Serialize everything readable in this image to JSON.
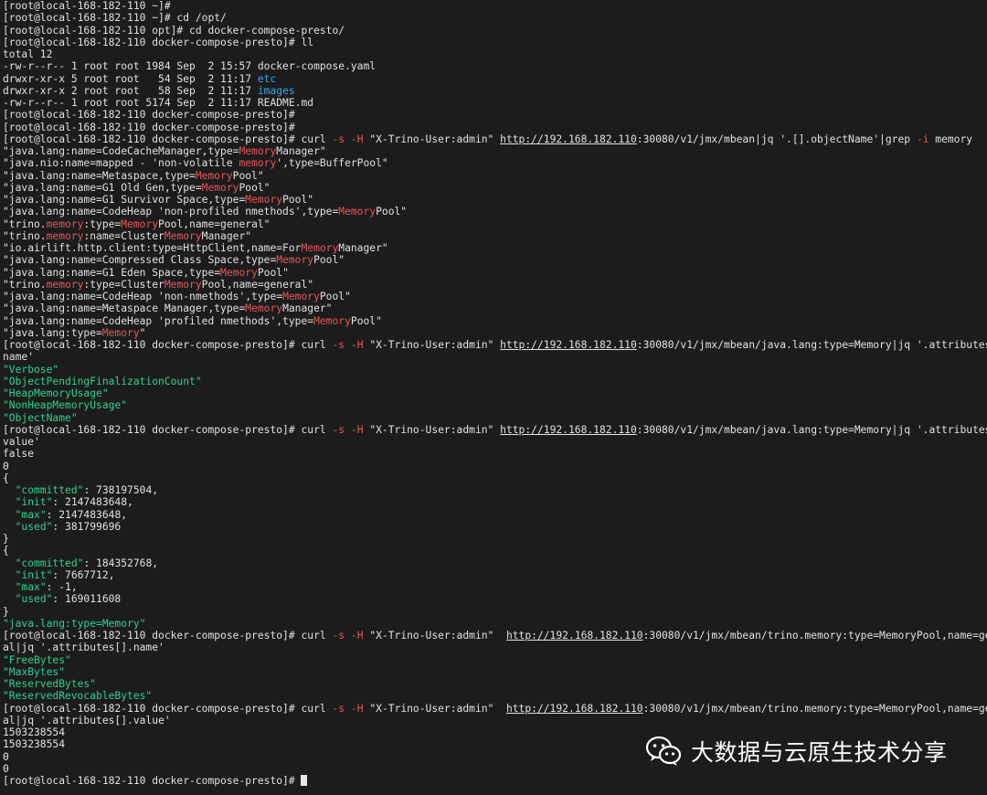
{
  "terminal": {
    "lines": [
      "[root@local-168-182-110 ~]#",
      "[root@local-168-182-110 ~]# cd /opt/",
      "[root@local-168-182-110 opt]# cd docker-compose-presto/",
      "[root@local-168-182-110 docker-compose-presto]# ll",
      "total 12",
      "-rw-r--r-- 1 root root 1984 Sep  2 15:57 docker-compose.yaml",
      "drwxr-xr-x 5 root root   54 Sep  2 11:17 etc",
      "drwxr-xr-x 2 root root   58 Sep  2 11:17 images",
      "-rw-r--r-- 1 root root 5174 Sep  2 11:17 README.md",
      "[root@local-168-182-110 docker-compose-presto]#",
      "[root@local-168-182-110 docker-compose-presto]#",
      "[root@local-168-182-110 docker-compose-presto]# curl -s -H \"X-Trino-User:admin\" http://192.168.182.110:30080/v1/jmx/mbean|jq '.[].objectName'|grep -i memory",
      "\"java.lang:name=CodeCacheManager,type=MemoryManager\"",
      "\"java.nio:name=mapped - 'non-volatile memory',type=BufferPool\"",
      "\"java.lang:name=Metaspace,type=MemoryPool\"",
      "\"java.lang:name=G1 Old Gen,type=MemoryPool\"",
      "\"java.lang:name=G1 Survivor Space,type=MemoryPool\"",
      "\"java.lang:name=CodeHeap 'non-profiled nmethods',type=MemoryPool\"",
      "\"trino.memory:type=MemoryPool,name=general\"",
      "\"trino.memory:name=ClusterMemoryManager\"",
      "\"io.airlift.http.client:type=HttpClient,name=ForMemoryManager\"",
      "\"java.lang:name=Compressed Class Space,type=MemoryPool\"",
      "\"java.lang:name=G1 Eden Space,type=MemoryPool\"",
      "\"trino.memory:type=ClusterMemoryPool,name=general\"",
      "\"java.lang:name=CodeHeap 'non-nmethods',type=MemoryPool\"",
      "\"java.lang:name=Metaspace Manager,type=MemoryManager\"",
      "\"java.lang:name=CodeHeap 'profiled nmethods',type=MemoryPool\"",
      "\"java.lang:type=Memory\"",
      "[root@local-168-182-110 docker-compose-presto]# curl -s -H \"X-Trino-User:admin\" http://192.168.182.110:30080/v1/jmx/mbean/java.lang:type=Memory|jq '.attributes[].",
      "name'",
      "\"Verbose\"",
      "\"ObjectPendingFinalizationCount\"",
      "\"HeapMemoryUsage\"",
      "\"NonHeapMemoryUsage\"",
      "\"ObjectName\"",
      "[root@local-168-182-110 docker-compose-presto]# curl -s -H \"X-Trino-User:admin\" http://192.168.182.110:30080/v1/jmx/mbean/java.lang:type=Memory|jq '.attributes[].",
      "value'",
      "false",
      "0",
      "{",
      "  \"committed\": 738197504,",
      "  \"init\": 2147483648,",
      "  \"max\": 2147483648,",
      "  \"used\": 381799696",
      "}",
      "{",
      "  \"committed\": 184352768,",
      "  \"init\": 7667712,",
      "  \"max\": -1,",
      "  \"used\": 169011608",
      "}",
      "\"java.lang:type=Memory\"",
      "[root@local-168-182-110 docker-compose-presto]# curl -s -H \"X-Trino-User:admin\"  http://192.168.182.110:30080/v1/jmx/mbean/trino.memory:type=MemoryPool,name=gener",
      "al|jq '.attributes[].name'",
      "\"FreeBytes\"",
      "\"MaxBytes\"",
      "\"ReservedBytes\"",
      "\"ReservedRevocableBytes\"",
      "[root@local-168-182-110 docker-compose-presto]# curl -s -H \"X-Trino-User:admin\"  http://192.168.182.110:30080/v1/jmx/mbean/trino.memory:type=MemoryPool,name=gener",
      "al|jq '.attributes[].value'",
      "1503238554",
      "1503238554",
      "0",
      "0",
      "[root@local-168-182-110 docker-compose-presto]# "
    ]
  },
  "watermark": {
    "text": "大数据与云原生技术分享",
    "icon": "wechat-icon"
  },
  "colors": {
    "background": "#1c1c1c",
    "foreground": "#e2e2e2",
    "highlight": "#e8555a",
    "string_green": "#2fd18f",
    "directory_blue": "#3aa6e8"
  }
}
